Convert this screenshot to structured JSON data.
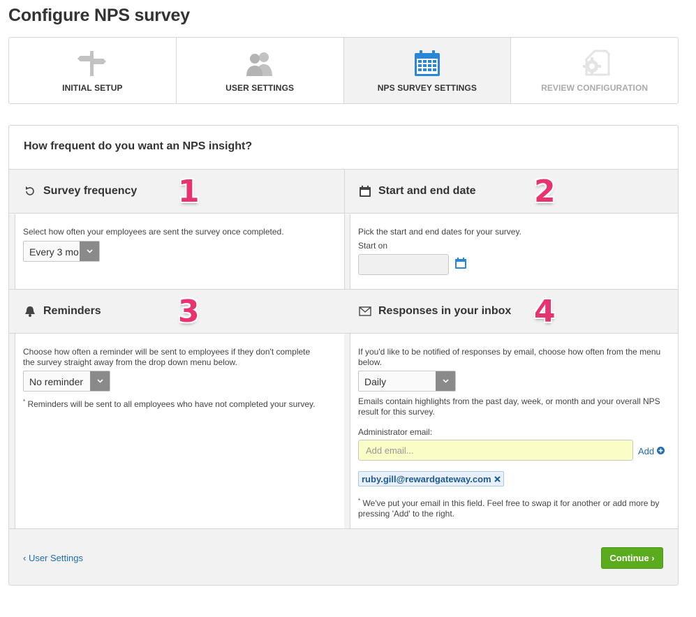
{
  "page": {
    "title": "Configure NPS survey"
  },
  "steps": [
    {
      "label": "INITIAL SETUP",
      "icon": "signpost-icon",
      "state": "done"
    },
    {
      "label": "USER SETTINGS",
      "icon": "users-icon",
      "state": "done"
    },
    {
      "label": "NPS SURVEY SETTINGS",
      "icon": "calendar-icon",
      "state": "active"
    },
    {
      "label": "REVIEW CONFIGURATION",
      "icon": "gear-icon",
      "state": "disabled"
    }
  ],
  "panel": {
    "heading": "How frequent do you want an NPS insight?"
  },
  "sections": {
    "frequency": {
      "title": "Survey frequency",
      "number": "1",
      "icon": "refresh-icon",
      "description": "Select how often your employees are sent the survey once completed.",
      "select_value": "Every 3 mo"
    },
    "dates": {
      "title": "Start and end date",
      "number": "2",
      "icon": "calendar-icon",
      "description": "Pick the start and end dates for your survey.",
      "start_label": "Start on",
      "start_value": ""
    },
    "reminders": {
      "title": "Reminders",
      "number": "3",
      "icon": "bell-icon",
      "description": "Choose how often a reminder will be sent to employees if they don't complete the survey straight away from the drop down menu below.",
      "select_value": "No reminder",
      "note": "Reminders will be sent to all employees who have not completed your survey."
    },
    "inbox": {
      "title": "Responses in your inbox",
      "number": "4",
      "icon": "envelope-icon",
      "description": "If you'd like to be notified of responses by email, choose how often from the menu below.",
      "select_value": "Daily",
      "summary": "Emails contain highlights from the past day, week, or month and your overall NPS result for this survey.",
      "admin_label": "Administrator email:",
      "email_placeholder": "Add email...",
      "add_label": "Add",
      "email_tag": "ruby.gill@rewardgateway.com",
      "note": "We've put your email in this field. Feel free to swap it for another or add more by pressing 'Add' to the right."
    }
  },
  "footer": {
    "back_label": "‹ User Settings",
    "continue_label": "Continue ›"
  },
  "colors": {
    "accent_number": "#e8336e",
    "active_step_icon": "#2a86d6",
    "continue_button": "#5aab1e",
    "link": "#1f6cb0",
    "email_input_bg": "#fbfdc6"
  }
}
